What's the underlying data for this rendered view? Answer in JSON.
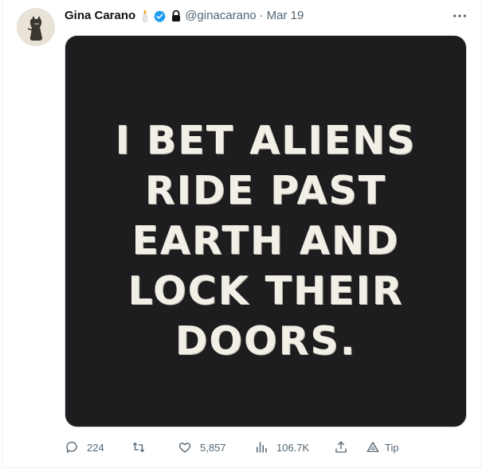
{
  "tweet": {
    "author_name": "Gina Carano",
    "handle": "@ginacarano",
    "separator": "·",
    "date": "Mar 19",
    "emoji_icon": "candle-icon",
    "verified_color": "#1d9bf0",
    "image_text_lines": [
      "I BET ALIENS",
      "RIDE PAST",
      "EARTH AND",
      "LOCK THEIR",
      "DOORS."
    ]
  },
  "actions": {
    "replies": "224",
    "retweets": "",
    "likes": "5,857",
    "views": "106.7K",
    "tip_label": "Tip"
  }
}
